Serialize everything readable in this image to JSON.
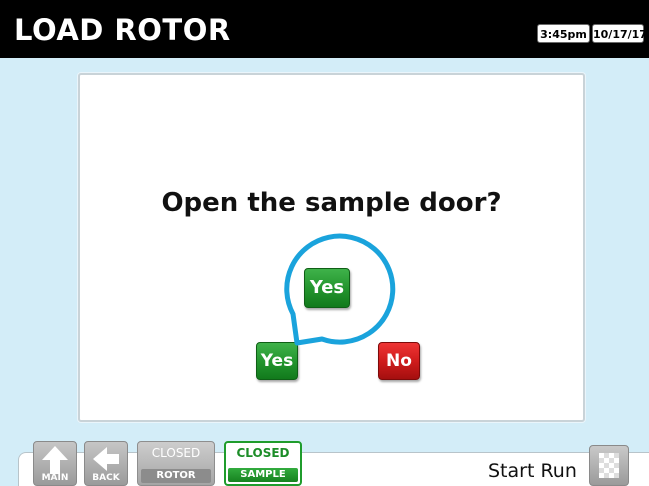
{
  "header": {
    "title": "LOAD ROTOR",
    "time": "3:45pm",
    "date": "10/17/17"
  },
  "dialog": {
    "prompt": "Open the sample door?",
    "yes_label": "Yes",
    "no_label": "No",
    "callout_yes_label": "Yes"
  },
  "toolbar": {
    "main_label": "MAIN",
    "back_label": "BACK",
    "rotor": {
      "state": "CLOSED",
      "label": "ROTOR"
    },
    "sample": {
      "state": "CLOSED",
      "label": "SAMPLE"
    },
    "start_run_label": "Start Run"
  },
  "icons": {
    "main": "up-arrow-icon",
    "back": "left-arrow-icon",
    "start_run": "checkered-flag-icon"
  },
  "colors": {
    "titlebar": "#000000",
    "background": "#d3edf8",
    "yes_green": "#24962f",
    "no_red": "#d01c1c",
    "callout_blue": "#1aa3dc",
    "sample_active_green": "#1f9c2c",
    "tool_gray": "#a5a5a5"
  }
}
